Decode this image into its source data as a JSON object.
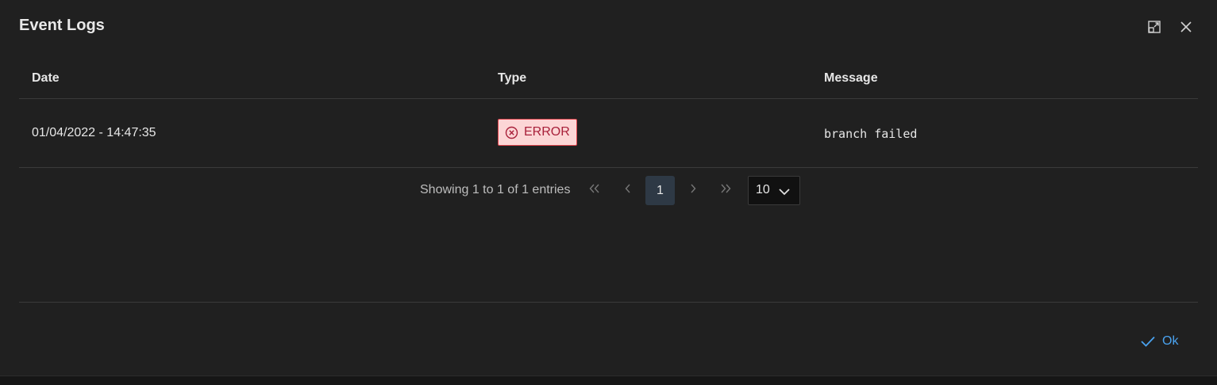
{
  "dialog": {
    "title": "Event Logs",
    "maximize_icon": "window-maximize-icon",
    "close_icon": "close-icon"
  },
  "table": {
    "columns": [
      "Date",
      "Type",
      "Message"
    ],
    "rows": [
      {
        "date": "01/04/2022 - 14:47:35",
        "type": "ERROR",
        "type_icon": "times-circle-icon",
        "message": "branch failed"
      }
    ]
  },
  "pagination": {
    "info": "Showing 1 to 1 of 1 entries",
    "current_page": "1",
    "rows_per_page": "10"
  },
  "footer": {
    "ok_label": "Ok",
    "ok_icon": "check-icon"
  },
  "colors": {
    "background": "#202020",
    "error_badge_bg": "#fcd6d6",
    "error_badge_text": "#a8203a",
    "accent": "#4aa3f0",
    "active_page_bg": "#2e3945"
  }
}
